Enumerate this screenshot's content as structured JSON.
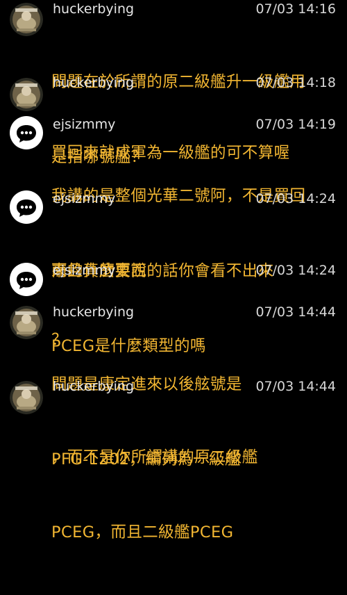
{
  "comments": [
    {
      "user": "huckerbying",
      "avatar_icon": "user-photo-avatar",
      "time": "07/03 14:16",
      "lines": [
        "問題在於所謂的原二級艦升一級艦用",
        "是指哪號艦？"
      ]
    },
    {
      "user": "huckerbying",
      "avatar_icon": "user-photo-avatar",
      "time": "07/03 14:18",
      "lines": [
        "買回來就成軍為一級艦的可不算喔"
      ]
    },
    {
      "user": "ejsizmmy",
      "avatar_icon": "chat-bubble-icon",
      "time": "07/03 14:19",
      "lines": [
        "我講的是整個光華二號阿，不是買回",
        "來的什麼東西"
      ]
    },
    {
      "user": "ejsizmmy",
      "avatar_icon": "chat-bubble-icon",
      "time": "07/03 14:24",
      "lines": [
        "而且真的要說的話你會看不出來",
        "PCEG是什麼類型的嗎"
      ]
    },
    {
      "user": "ejsizmmy",
      "avatar_icon": "chat-bubble-icon",
      "time": "07/03 14:24",
      "lines": [
        "？"
      ]
    },
    {
      "user": "huckerbying",
      "avatar_icon": "user-photo-avatar",
      "time": "07/03 14:44",
      "lines": [
        "問題是康定進來以後舷號是",
        "PFG-1202，編列為一級艦"
      ]
    },
    {
      "user": "huckerbying",
      "avatar_icon": "user-photo-avatar",
      "time": "07/03 14:44",
      "lines": [
        "，而不是你所謂講的原二級艦",
        "PCEG，而且二級艦PCEG"
      ]
    }
  ],
  "colors": {
    "background": "#000000",
    "comment_text": "#f2b632",
    "meta_text": "#e6e6e6"
  }
}
